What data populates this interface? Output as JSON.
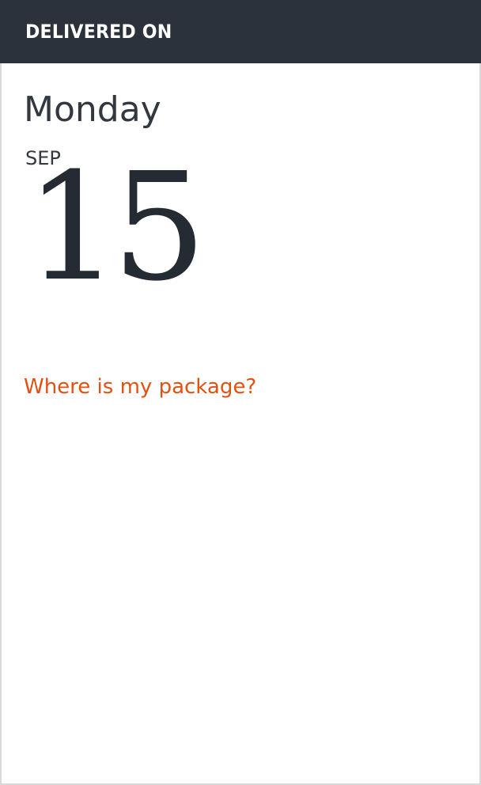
{
  "header": {
    "title": "DELIVERED ON"
  },
  "delivery": {
    "weekday": "Monday",
    "month": "SEP",
    "day": "15"
  },
  "links": {
    "where_package": "Where is my package?"
  },
  "colors": {
    "header_bg": "#2b323b",
    "text_dark": "#333840",
    "date_number": "#252b33",
    "link": "#e45010",
    "border": "#d8d9db"
  }
}
